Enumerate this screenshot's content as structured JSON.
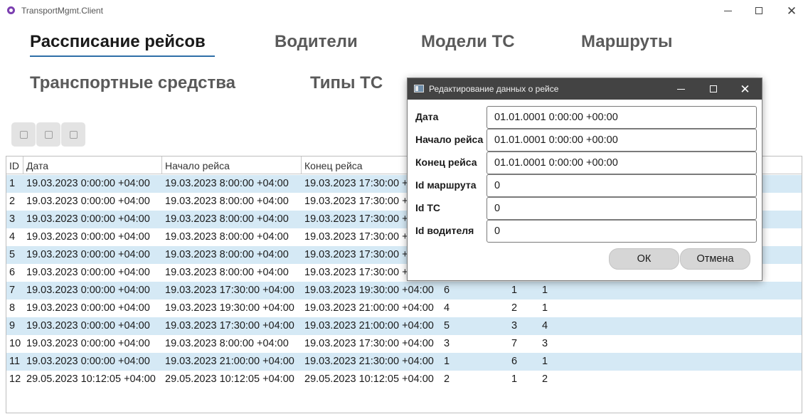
{
  "window": {
    "title": "TransportMgmt.Client"
  },
  "tabs": [
    {
      "label": "Рассписание рейсов"
    },
    {
      "label": "Водители"
    },
    {
      "label": "Модели ТС"
    },
    {
      "label": "Маршруты"
    },
    {
      "label": "Транспортные средства"
    },
    {
      "label": "Типы ТС"
    }
  ],
  "toolbar": [
    "edit-icon",
    "add-icon",
    "delete-icon"
  ],
  "table": {
    "columns": [
      "ID",
      "Дата",
      "Начало рейса",
      "Конец рейса"
    ],
    "rows": [
      [
        "1",
        "19.03.2023 0:00:00 +04:00",
        "19.03.2023 8:00:00 +04:00",
        "19.03.2023 17:30:00 +04:00",
        "",
        "",
        ""
      ],
      [
        "2",
        "19.03.2023 0:00:00 +04:00",
        "19.03.2023 8:00:00 +04:00",
        "19.03.2023 17:30:00 +04:00",
        "",
        "",
        ""
      ],
      [
        "3",
        "19.03.2023 0:00:00 +04:00",
        "19.03.2023 8:00:00 +04:00",
        "19.03.2023 17:30:00 +04:00",
        "",
        "",
        ""
      ],
      [
        "4",
        "19.03.2023 0:00:00 +04:00",
        "19.03.2023 8:00:00 +04:00",
        "19.03.2023 17:30:00 +04:00",
        "",
        "",
        ""
      ],
      [
        "5",
        "19.03.2023 0:00:00 +04:00",
        "19.03.2023 8:00:00 +04:00",
        "19.03.2023 17:30:00 +04:00",
        "",
        "",
        ""
      ],
      [
        "6",
        "19.03.2023 0:00:00 +04:00",
        "19.03.2023 8:00:00 +04:00",
        "19.03.2023 17:30:00 +04:00",
        "",
        "",
        ""
      ],
      [
        "7",
        "19.03.2023 0:00:00 +04:00",
        "19.03.2023 17:30:00 +04:00",
        "19.03.2023 19:30:00 +04:00",
        "6",
        "1",
        "1"
      ],
      [
        "8",
        "19.03.2023 0:00:00 +04:00",
        "19.03.2023 19:30:00 +04:00",
        "19.03.2023 21:00:00 +04:00",
        "4",
        "2",
        "1"
      ],
      [
        "9",
        "19.03.2023 0:00:00 +04:00",
        "19.03.2023 17:30:00 +04:00",
        "19.03.2023 21:00:00 +04:00",
        "5",
        "3",
        "4"
      ],
      [
        "10",
        "19.03.2023 0:00:00 +04:00",
        "19.03.2023 8:00:00 +04:00",
        "19.03.2023 17:30:00 +04:00",
        "3",
        "7",
        "3"
      ],
      [
        "11",
        "19.03.2023 0:00:00 +04:00",
        "19.03.2023 21:00:00 +04:00",
        "19.03.2023 21:30:00 +04:00",
        "1",
        "6",
        "1"
      ],
      [
        "12",
        "29.05.2023 10:12:05 +04:00",
        "29.05.2023 10:12:05 +04:00",
        "29.05.2023 10:12:05 +04:00",
        "2",
        "1",
        "2"
      ]
    ]
  },
  "dialog": {
    "title": "Редактирование данных о рейсе",
    "fields": [
      {
        "label": "Дата",
        "value": "01.01.0001 0:00:00 +00:00"
      },
      {
        "label": "Начало рейса",
        "value": "01.01.0001 0:00:00 +00:00"
      },
      {
        "label": "Конец рейса",
        "value": "01.01.0001 0:00:00 +00:00"
      },
      {
        "label": "Id маршрута",
        "value": "0"
      },
      {
        "label": "Id ТС",
        "value": "0"
      },
      {
        "label": "Id водителя",
        "value": "0"
      }
    ],
    "ok_label": "ОК",
    "cancel_label": "Отмена"
  }
}
